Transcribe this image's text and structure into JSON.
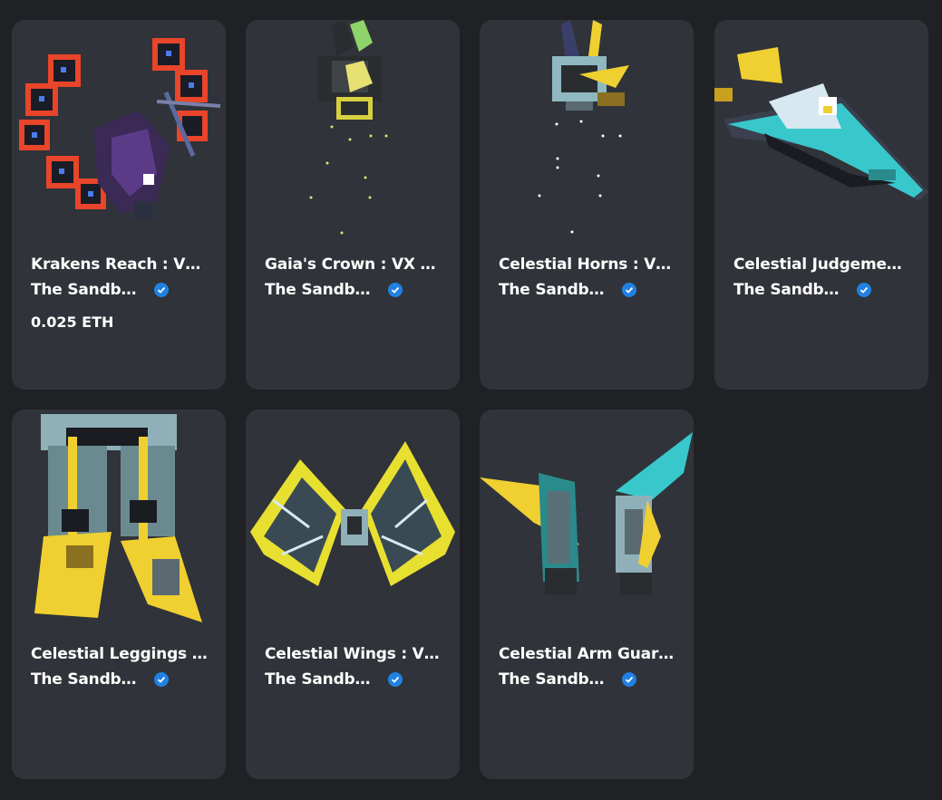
{
  "colors": {
    "background": "#202124",
    "card": "#303339",
    "text": "#ffffff",
    "verified": "#2081e2"
  },
  "cards": [
    {
      "title": "Krakens Reach : V…",
      "creator": "The Sandbo…",
      "price": "0.025 ETH"
    },
    {
      "title": "Gaia's Crown : VX …",
      "creator": "The Sandbo…"
    },
    {
      "title": "Celestial Horns : V…",
      "creator": "The Sandbo…"
    },
    {
      "title": "Celestial Judgeme…",
      "creator": "The Sandbo…"
    },
    {
      "title": "Celestial Leggings …",
      "creator": "The Sandbo…"
    },
    {
      "title": "Celestial Wings : V…",
      "creator": "The Sandbo…"
    },
    {
      "title": "Celestial Arm Guar…",
      "creator": "The Sandbo…"
    }
  ]
}
